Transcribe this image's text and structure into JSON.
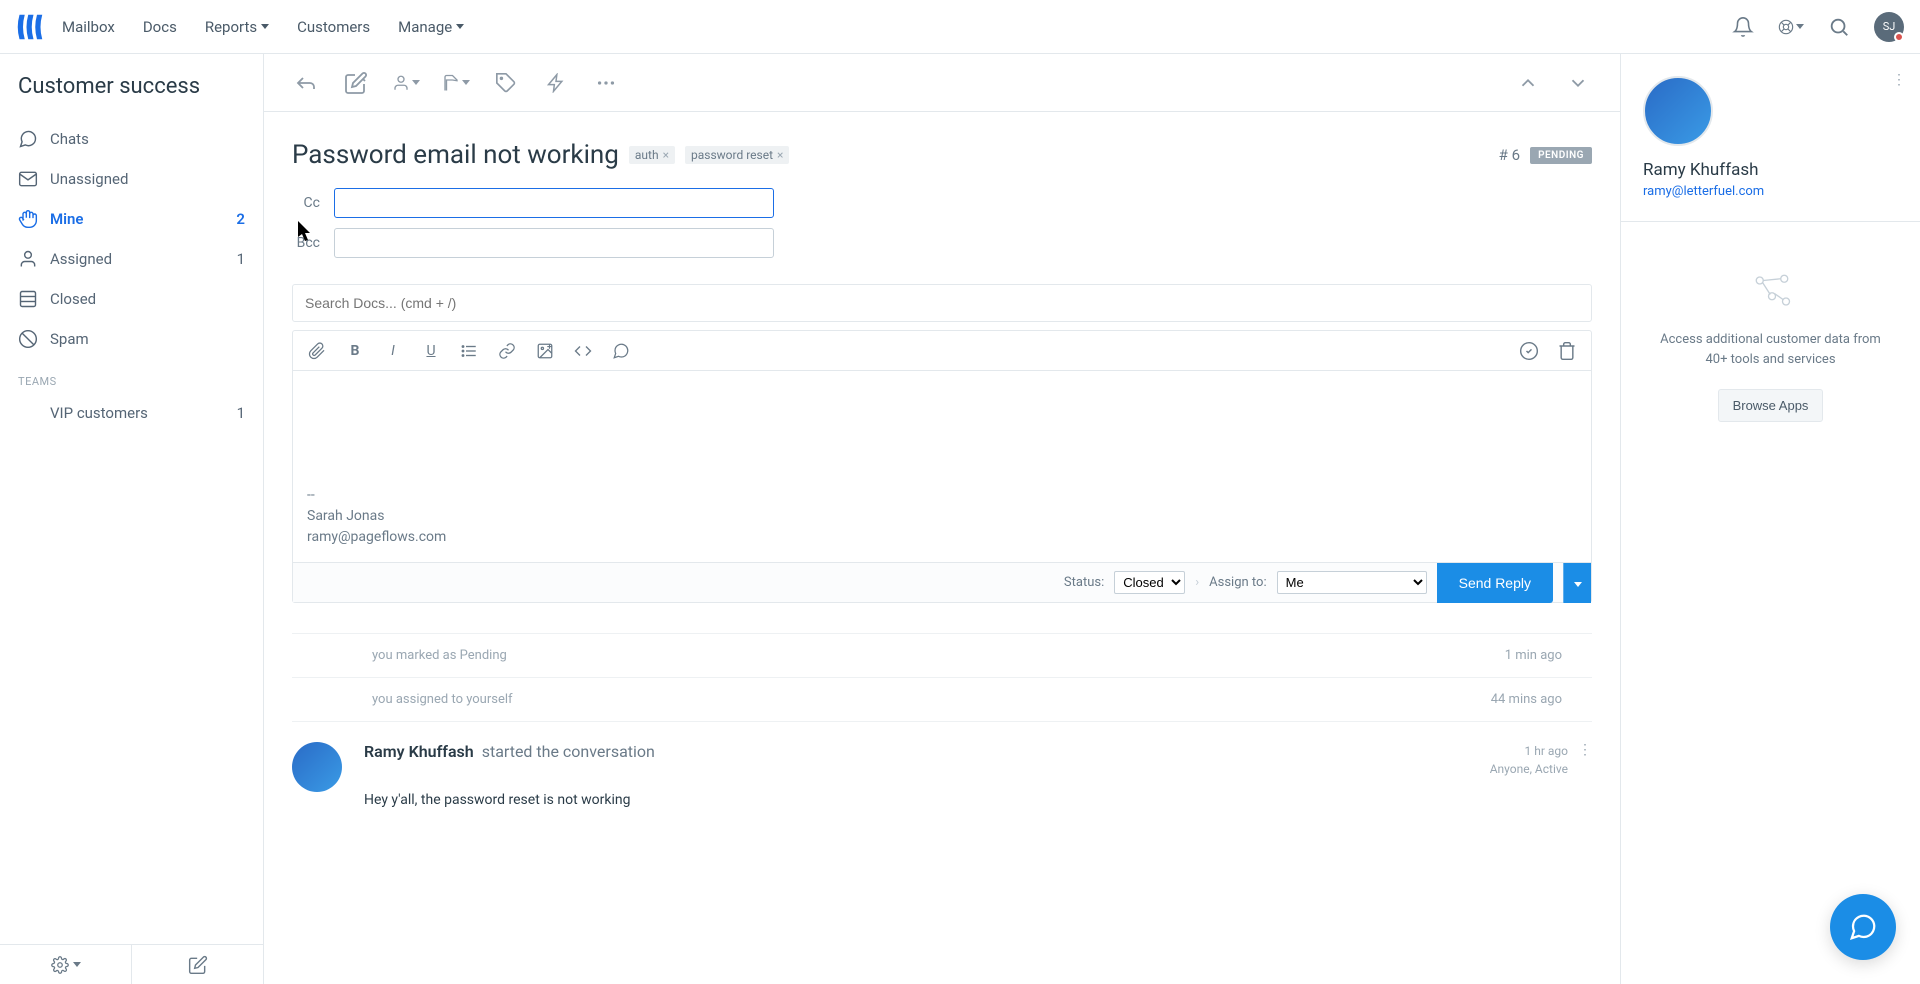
{
  "topnav": {
    "items": [
      "Mailbox",
      "Docs",
      "Reports",
      "Customers",
      "Manage"
    ],
    "avatar_initials": "SJ"
  },
  "sidebar": {
    "title": "Customer success",
    "items": [
      {
        "icon": "chat",
        "label": "Chats",
        "count": ""
      },
      {
        "icon": "email",
        "label": "Unassigned",
        "count": ""
      },
      {
        "icon": "hand",
        "label": "Mine",
        "count": "2",
        "active": true
      },
      {
        "icon": "user",
        "label": "Assigned",
        "count": "1"
      },
      {
        "icon": "archive",
        "label": "Closed",
        "count": ""
      },
      {
        "icon": "spam",
        "label": "Spam",
        "count": ""
      }
    ],
    "teams_header": "TEAMS",
    "teams": [
      {
        "label": "VIP customers",
        "count": "1"
      }
    ]
  },
  "convo": {
    "subject": "Password email not working",
    "tags": [
      "auth",
      "password reset"
    ],
    "id_prefix": "#",
    "id": "6",
    "status": "PENDING",
    "cc_label": "Cc",
    "bcc_label": "Bcc",
    "search_placeholder": "Search Docs... (cmd + /)",
    "signature_sep": "--",
    "signature_name": "Sarah Jonas",
    "signature_email": "ramy@pageflows.com",
    "status_label": "Status:",
    "status_value": "Closed",
    "assign_label": "Assign to:",
    "assign_value": "Me",
    "send_label": "Send Reply"
  },
  "history": [
    {
      "text": "you marked as Pending",
      "time": "1 min ago"
    },
    {
      "text": "you assigned to yourself",
      "time": "44 mins ago"
    }
  ],
  "message": {
    "name": "Ramy Khuffash",
    "action": "started the conversation",
    "time": "1 hr ago",
    "meta": "Anyone, Active",
    "body": "Hey y'all, the password reset is not working"
  },
  "customer": {
    "name": "Ramy Khuffash",
    "email": "ramy@letterfuel.com"
  },
  "apps": {
    "text": "Access additional customer data from 40+ tools and services",
    "button": "Browse Apps"
  }
}
